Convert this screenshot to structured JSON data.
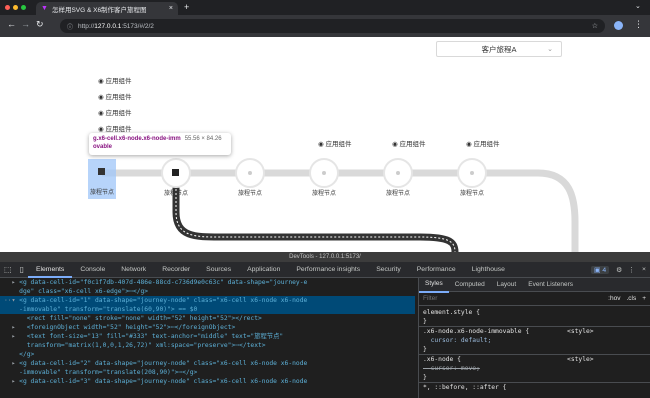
{
  "browser": {
    "tab_title": "怎样用SVG & X6制作客户旅程图",
    "url_prefix": "http://",
    "url_host": "127.0.0.1",
    "url_rest": ":5173/#/2/2"
  },
  "page": {
    "journey_select": "客户旅程A",
    "component_label": "应用组件",
    "node_label": "旅程节点",
    "inspect_tooltip_selector": "g.x6-cell.x6-node.x6-node-imm",
    "inspect_tooltip_selector2": "ovable",
    "inspect_tooltip_size": "55.56 × 84.26",
    "stacked_components": [
      "应用组件",
      "应用组件",
      "应用组件",
      "应用组件"
    ],
    "nodes": [
      {
        "label": "旅程节点",
        "component": ""
      },
      {
        "label": "旅程节点",
        "component": ""
      },
      {
        "label": "旅程节点",
        "component": ""
      },
      {
        "label": "旅程节点",
        "component": "应用组件"
      },
      {
        "label": "旅程节点",
        "component": "应用组件"
      },
      {
        "label": "旅程节点",
        "component": "应用组件"
      }
    ]
  },
  "devtools": {
    "title": "DevTools - 127.0.0.1:5173/",
    "tabs": [
      "Elements",
      "Console",
      "Network",
      "Recorder",
      "Sources",
      "Application",
      "Performance insights",
      "Security",
      "Performance",
      "Lighthouse"
    ],
    "issues_count": "4",
    "elements_lines": [
      "<g data-cell-id=\"f0c1f7db-407d-486e-88cd-c736d9e0c63c\" data-shape=\"journey-e",
      "dge\" class=\"x6-cell x6-edge\">⋯</g>",
      "<g data-cell-id=\"1\" data-shape=\"journey-node\" class=\"x6-cell x6-node x6-node",
      "-immovable\" transform=\"translate(60,90)\"> == $0",
      "  <rect fill=\"none\" stroke=\"none\" width=\"52\" height=\"52\"></rect>",
      "  <foreignObject width=\"52\" height=\"52\">⋯</foreignObject>",
      "  <text font-size=\"13\" fill=\"#333\" text-anchor=\"middle\" text=\"旅程节点\"",
      "  transform=\"matrix(1,0,0,1,26,72)\" xml:space=\"preserve\">⋯</text>",
      "</g>",
      "<g data-cell-id=\"2\" data-shape=\"journey-node\" class=\"x6-cell x6-node x6-node",
      "-immovable\" transform=\"translate(208,90)\">⋯</g>",
      "<g data-cell-id=\"3\" data-shape=\"journey-node\" class=\"x6-cell x6-node x6-node"
    ],
    "styles_tabs": [
      "Styles",
      "Computed",
      "Layout",
      "Event Listeners"
    ],
    "filter_placeholder": "Filter",
    "hov": ":hov",
    "cls": ".cls",
    "style_lines": [
      "element.style {",
      "}",
      ".x6-node.x6-node-immovable {          <style>",
      "  cursor: default;",
      "}",
      ".x6-node {                            <style>",
      "  cursor: move;",
      "}",
      "*, ::before, ::after {"
    ]
  }
}
